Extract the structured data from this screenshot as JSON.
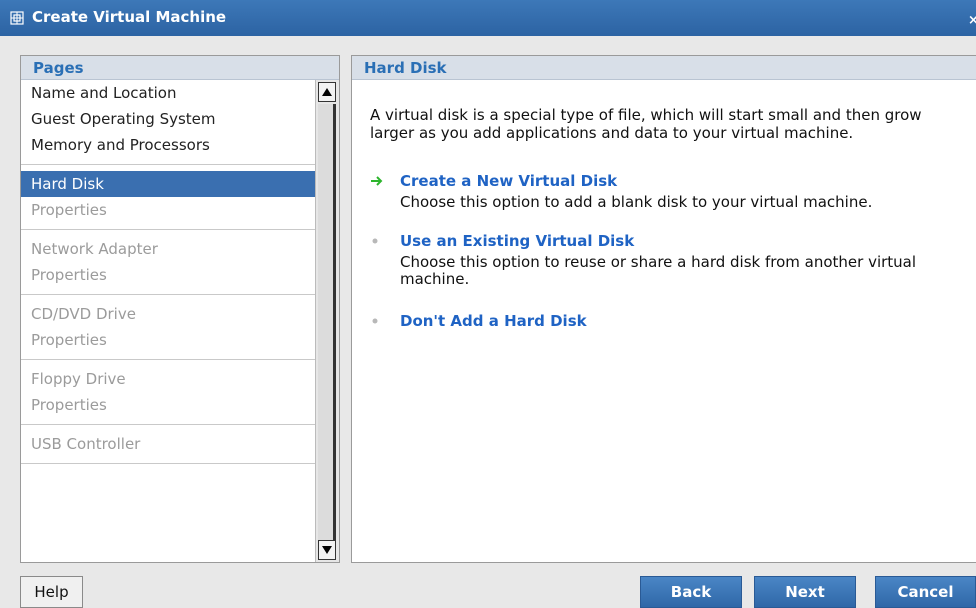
{
  "window": {
    "title": "Create Virtual Machine",
    "icon": "virtual-machine-icon",
    "close_glyph": "×"
  },
  "pages": {
    "header": "Pages",
    "groups": [
      {
        "items": [
          {
            "label": "Name and Location",
            "state": "normal"
          },
          {
            "label": "Guest Operating System",
            "state": "normal"
          },
          {
            "label": "Memory and Processors",
            "state": "normal"
          }
        ]
      },
      {
        "items": [
          {
            "label": "Hard Disk",
            "state": "selected"
          },
          {
            "label": "Properties",
            "state": "disabled"
          }
        ]
      },
      {
        "items": [
          {
            "label": "Network Adapter",
            "state": "disabled"
          },
          {
            "label": "Properties",
            "state": "disabled"
          }
        ]
      },
      {
        "items": [
          {
            "label": "CD/DVD Drive",
            "state": "disabled"
          },
          {
            "label": "Properties",
            "state": "disabled"
          }
        ]
      },
      {
        "items": [
          {
            "label": "Floppy Drive",
            "state": "disabled"
          },
          {
            "label": "Properties",
            "state": "disabled"
          }
        ]
      },
      {
        "items": [
          {
            "label": "USB Controller",
            "state": "disabled"
          }
        ]
      }
    ]
  },
  "content": {
    "header": "Hard Disk",
    "intro": "A virtual disk is a special type of file, which will start small and then grow larger as you add applications and data to your virtual machine.",
    "options": [
      {
        "label": "Create a New Virtual Disk",
        "description": "Choose this option to add a blank disk to your virtual machine.",
        "selected": true
      },
      {
        "label": "Use an Existing Virtual Disk",
        "description": "Choose this option to reuse or share a hard disk from another virtual machine.",
        "selected": false
      },
      {
        "label": "Don't Add a Hard Disk",
        "description": "",
        "selected": false
      }
    ]
  },
  "buttons": {
    "help": "Help",
    "back": "Back",
    "next": "Next",
    "cancel": "Cancel"
  },
  "colors": {
    "accent": "#3a6fb0",
    "link": "#1f63c4",
    "selected_arrow": "#2db52d",
    "bullet": "#b8b8b8"
  }
}
